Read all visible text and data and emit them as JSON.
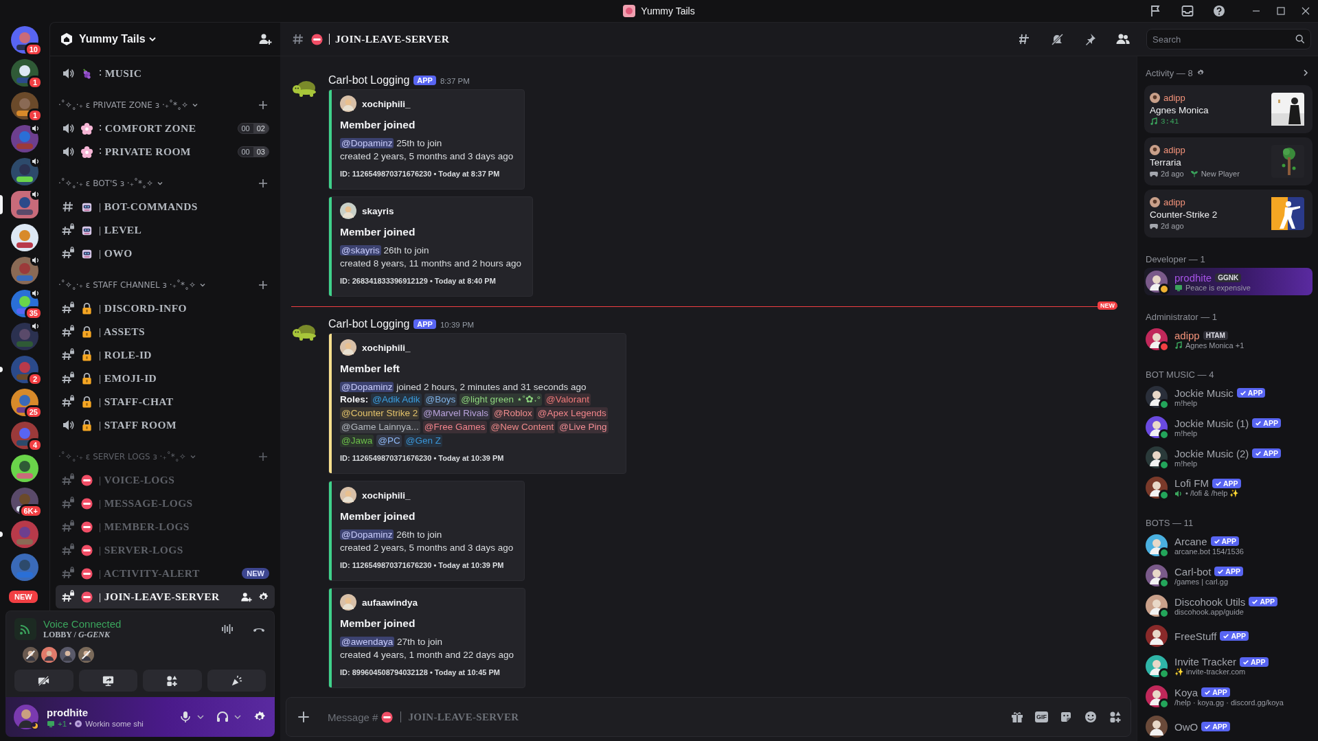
{
  "window": {
    "title": "Yummy Tails"
  },
  "servers": [
    {
      "badge": "10",
      "selected": false,
      "voice": false,
      "unread": false
    },
    {
      "badge": "1",
      "selected": false,
      "voice": false,
      "unread": false
    },
    {
      "badge": "1",
      "selected": false,
      "voice": false,
      "unread": false
    },
    {
      "selected": false,
      "voice": true,
      "unread": false
    },
    {
      "selected": false,
      "voice": true,
      "unread": false
    },
    {
      "selected": true,
      "voice": true,
      "unread": false
    },
    {
      "selected": false,
      "voice": false,
      "unread": false
    },
    {
      "selected": false,
      "voice": true,
      "unread": false
    },
    {
      "badge": "35",
      "selected": false,
      "voice": true,
      "unread": false
    },
    {
      "selected": false,
      "voice": true,
      "unread": false
    },
    {
      "badge": "2",
      "selected": false,
      "voice": false,
      "unread": true
    },
    {
      "badge": "25",
      "selected": false,
      "voice": false,
      "unread": false
    },
    {
      "badge": "4",
      "selected": false,
      "voice": false,
      "unread": false
    },
    {
      "selected": false,
      "voice": false,
      "unread": false
    },
    {
      "badge": "6K+",
      "selected": false,
      "voice": false,
      "unread": false
    },
    {
      "selected": false,
      "voice": false,
      "unread": true
    },
    {
      "selected": false,
      "voice": false,
      "unread": false
    }
  ],
  "rail_pill": "NEW",
  "sidebar": {
    "server_name": "Yummy Tails",
    "sections": [
      {
        "channels": [
          {
            "kind": "voice",
            "divider": "∶",
            "name": "MUSIC",
            "muted": false,
            "selected": false
          }
        ]
      },
      {
        "title": "‧˚✧˳‧₊ ɛ PRIVATE ZONE ɜ ‧₊˚*˳✧",
        "muted": false,
        "channels": [
          {
            "kind": "voice",
            "divider": "∶",
            "name": "COMFORT ZONE",
            "users": "00",
            "limit": "02",
            "muted": false,
            "selected": false
          },
          {
            "kind": "voice",
            "divider": "∶",
            "name": "PRIVATE ROOM",
            "users": "00",
            "limit": "03",
            "muted": false,
            "selected": false
          }
        ]
      },
      {
        "title": "‧˚✧˳‧₊ ɛ BOT'S ɜ ‧₊˚*˳✧",
        "muted": false,
        "channels": [
          {
            "kind": "text",
            "divider": "|",
            "name": "BOT-COMMANDS",
            "muted": false,
            "selected": false
          },
          {
            "kind": "text_private",
            "divider": "|",
            "name": "LEVEL",
            "muted": false,
            "selected": false
          },
          {
            "kind": "text_private",
            "divider": "|",
            "name": "OWO",
            "muted": false,
            "selected": false
          }
        ]
      },
      {
        "title": "‧˚✧˳‧₊ ɛ STAFF CHANNEL ɜ ‧₊˚*˳✧",
        "muted": false,
        "channels": [
          {
            "kind": "text_private",
            "divider": "|",
            "name": "DISCORD-INFO",
            "muted": false,
            "selected": false
          },
          {
            "kind": "text_private",
            "divider": "|",
            "name": "ASSETS",
            "muted": false,
            "selected": false
          },
          {
            "kind": "text_private",
            "divider": "|",
            "name": "ROLE-ID",
            "muted": false,
            "selected": false
          },
          {
            "kind": "text_private",
            "divider": "|",
            "name": "EMOJI-ID",
            "muted": false,
            "selected": false
          },
          {
            "kind": "text_private",
            "divider": "|",
            "name": "STAFF-CHAT",
            "muted": false,
            "selected": false
          },
          {
            "kind": "voice",
            "divider": "|",
            "name": "STAFF ROOM",
            "muted": false,
            "selected": false
          }
        ]
      },
      {
        "title": "‧˚✧˳‧₊ ɛ SERVER LOGS ɜ ‧₊˚*˳✧",
        "muted": true,
        "channels": [
          {
            "kind": "text_private",
            "divider": "|",
            "name": "VOICE-LOGS",
            "muted": true,
            "selected": false
          },
          {
            "kind": "text_private",
            "divider": "|",
            "name": "MESSAGE-LOGS",
            "muted": true,
            "selected": false
          },
          {
            "kind": "text_private",
            "divider": "|",
            "name": "MEMBER-LOGS",
            "muted": true,
            "selected": false
          },
          {
            "kind": "text_private",
            "divider": "|",
            "name": "SERVER-LOGS",
            "muted": true,
            "selected": false
          },
          {
            "kind": "text_private",
            "divider": "|",
            "name": "ACTIVITY-ALERT",
            "badge": "NEW",
            "muted": true,
            "selected": false
          },
          {
            "kind": "text_private",
            "divider": "|",
            "name": "JOIN-LEAVE-SERVER",
            "muted": false,
            "selected": true
          }
        ]
      }
    ]
  },
  "voice": {
    "status": "Voice Connected",
    "channel": "LOBBY / *G-GENK*",
    "participants": [
      {
        "muted": true
      },
      {
        "muted": false
      },
      {
        "muted": false
      },
      {
        "muted": true
      }
    ]
  },
  "user": {
    "name": "prodhite",
    "activity_count": "+1",
    "status": "Workin some shi"
  },
  "chat": {
    "channel": "JOIN-LEAVE-SERVER",
    "search_placeholder": "Search",
    "new_label": "NEW",
    "groups": [
      {
        "author": "Carl-bot Logging",
        "badge": "APP",
        "time": "8:37 PM",
        "new_before": false,
        "embeds": [
          {
            "color": "#3fd28b",
            "user": "xochiphili_",
            "title": "Member joined",
            "mention": "@Dopaminz",
            "text": "25th to join",
            "line": "created 2 years, 5 months and 3 days ago",
            "footer": "ID: 1126549870371676230 • Today at 8:37 PM"
          },
          {
            "color": "#3fd28b",
            "user": "skayris",
            "title": "Member joined",
            "mention": "@skayris",
            "text": "26th to join",
            "line": "created 8 years, 11 months and 2 hours ago",
            "footer": "ID: 268341833396912129 • Today at 8:40 PM"
          }
        ]
      },
      {
        "author": "Carl-bot Logging",
        "badge": "APP",
        "time": "10:39 PM",
        "new_before": true,
        "embeds": [
          {
            "color": "#f8e08e",
            "user": "xochiphili_",
            "title": "Member left",
            "mention": "@Dopaminz",
            "text": "joined 2 hours, 2 minutes and 31 seconds ago",
            "roles_label": "Roles:",
            "roles": [
              {
                "text": "@Adik Adik",
                "color": "#3b9fe0"
              },
              {
                "text": "@Boys",
                "color": "#7fb2e5"
              },
              {
                "text": "@light green ⋆˚✿˖°",
                "color": "#8ed67e"
              },
              {
                "text": "@Valorant",
                "color": "#f07a7a"
              },
              {
                "text": "@Counter Strike 2",
                "color": "#e5c46b"
              },
              {
                "text": "@Marvel Rivals",
                "color": "#b9a3dc"
              },
              {
                "text": "@Roblox",
                "color": "#f08d8d"
              },
              {
                "text": "@Apex Legends",
                "color": "#f0858a"
              },
              {
                "text": "@Game Lainnya...",
                "color": "#b5bac1"
              },
              {
                "text": "@Free Games",
                "color": "#f2848c"
              },
              {
                "text": "@New Content",
                "color": "#ef8a8a"
              },
              {
                "text": "@Live Ping",
                "color": "#f28e95"
              },
              {
                "text": "@Jawa",
                "color": "#6cc04a"
              },
              {
                "text": "@PC",
                "color": "#8fb8f5"
              },
              {
                "text": "@Gen Z",
                "color": "#3a96d8"
              }
            ],
            "footer": "ID: 1126549870371676230 • Today at 10:39 PM"
          },
          {
            "color": "#3fd28b",
            "user": "xochiphili_",
            "title": "Member joined",
            "mention": "@Dopaminz",
            "text": "26th to join",
            "line": "created 2 years, 5 months and 3 days ago",
            "footer": "ID: 1126549870371676230 • Today at 10:39 PM"
          },
          {
            "color": "#3fd28b",
            "user": "aufaawindya",
            "title": "Member joined",
            "mention": "@awendaya",
            "text": "27th to join",
            "line": "created 4 years, 1 month and 22 days ago",
            "footer": "ID: 899604508794032128 • Today at 10:45 PM"
          }
        ]
      }
    ],
    "composer": {
      "placeholder": "Message #",
      "channel": "JOIN-LEAVE-SERVER",
      "gif_label": "GIF"
    }
  },
  "members": {
    "activity": {
      "title": "Activity — 8",
      "cards": [
        {
          "kind": "music",
          "user": "adipp",
          "title": "Agnes Monica",
          "detail": "3:41"
        },
        {
          "kind": "game",
          "user": "adipp",
          "title": "Terraria",
          "detail": "2d ago",
          "extra": "New Player"
        },
        {
          "kind": "game",
          "user": "adipp",
          "title": "Counter-Strike 2",
          "detail": "2d ago"
        }
      ]
    },
    "groups": [
      {
        "title": "Developer — 1",
        "members": [
          {
            "kind": "monitor",
            "name": "prodhite",
            "color": "#a653e6",
            "tag": "GGNK",
            "status": "Peace is expensive",
            "presence": {
              "color": "#f0b232"
            },
            "highlight": true
          }
        ]
      },
      {
        "title": "Administrator — 1",
        "members": [
          {
            "kind": "music",
            "name": "adipp",
            "color": "#f3937a",
            "tag": "HTAM",
            "status": "Agnes Monica +1",
            "presence": {
              "color": "#f23f43"
            },
            "highlight": false
          }
        ]
      },
      {
        "title": "BOT MUSIC — 4",
        "members": [
          {
            "kind": "plain",
            "name": "Jockie Music",
            "color": "#a3a6ad",
            "badge": "APP",
            "status": "m!help",
            "presence": {
              "color": "#23a55a"
            },
            "highlight": false
          },
          {
            "kind": "plain",
            "name": "Jockie Music (1)",
            "color": "#a3a6ad",
            "badge": "APP",
            "status": "m!help",
            "presence": {
              "color": "#23a55a"
            },
            "highlight": false
          },
          {
            "kind": "plain",
            "name": "Jockie Music (2)",
            "color": "#a3a6ad",
            "badge": "APP",
            "status": "m!help",
            "presence": {
              "color": "#23a55a"
            },
            "highlight": false
          },
          {
            "kind": "speaker",
            "name": "Lofi FM",
            "color": "#a3a6ad",
            "badge": "APP",
            "status": "• /lofi & /help ✨",
            "presence": {
              "color": "#23a55a"
            },
            "highlight": false
          }
        ]
      },
      {
        "title": "BOTS — 11",
        "members": [
          {
            "kind": "plain",
            "name": "Arcane",
            "color": "#a3a6ad",
            "badge": "APP",
            "status": "arcane.bot 154/1536",
            "presence": {
              "color": "#23a55a"
            },
            "highlight": false
          },
          {
            "kind": "plain",
            "name": "Carl-bot",
            "color": "#a3a6ad",
            "badge": "APP",
            "status": "/games | carl.gg",
            "presence": {
              "color": "#23a55a"
            },
            "highlight": false
          },
          {
            "kind": "plain",
            "name": "Discohook Utils",
            "color": "#a3a6ad",
            "badge": "APP",
            "status": "discohook.app/guide",
            "presence": {
              "color": "#23a55a"
            },
            "highlight": false
          },
          {
            "name": "FreeStuff",
            "color": "#a3a6ad",
            "badge": "APP",
            "highlight": false
          },
          {
            "kind": "plain",
            "name": "Invite Tracker",
            "color": "#a3a6ad",
            "badge": "APP",
            "status": "✨ invite-tracker.com",
            "presence": {
              "color": "#23a55a"
            },
            "highlight": false
          },
          {
            "kind": "plain",
            "name": "Koya",
            "color": "#a3a6ad",
            "badge": "APP",
            "status": "/help · koya.gg · discord.gg/koya",
            "presence": {
              "color": "#23a55a"
            },
            "highlight": false
          },
          {
            "name": "OwO",
            "color": "#a3a6ad",
            "badge": "APP",
            "highlight": false
          }
        ]
      }
    ]
  }
}
